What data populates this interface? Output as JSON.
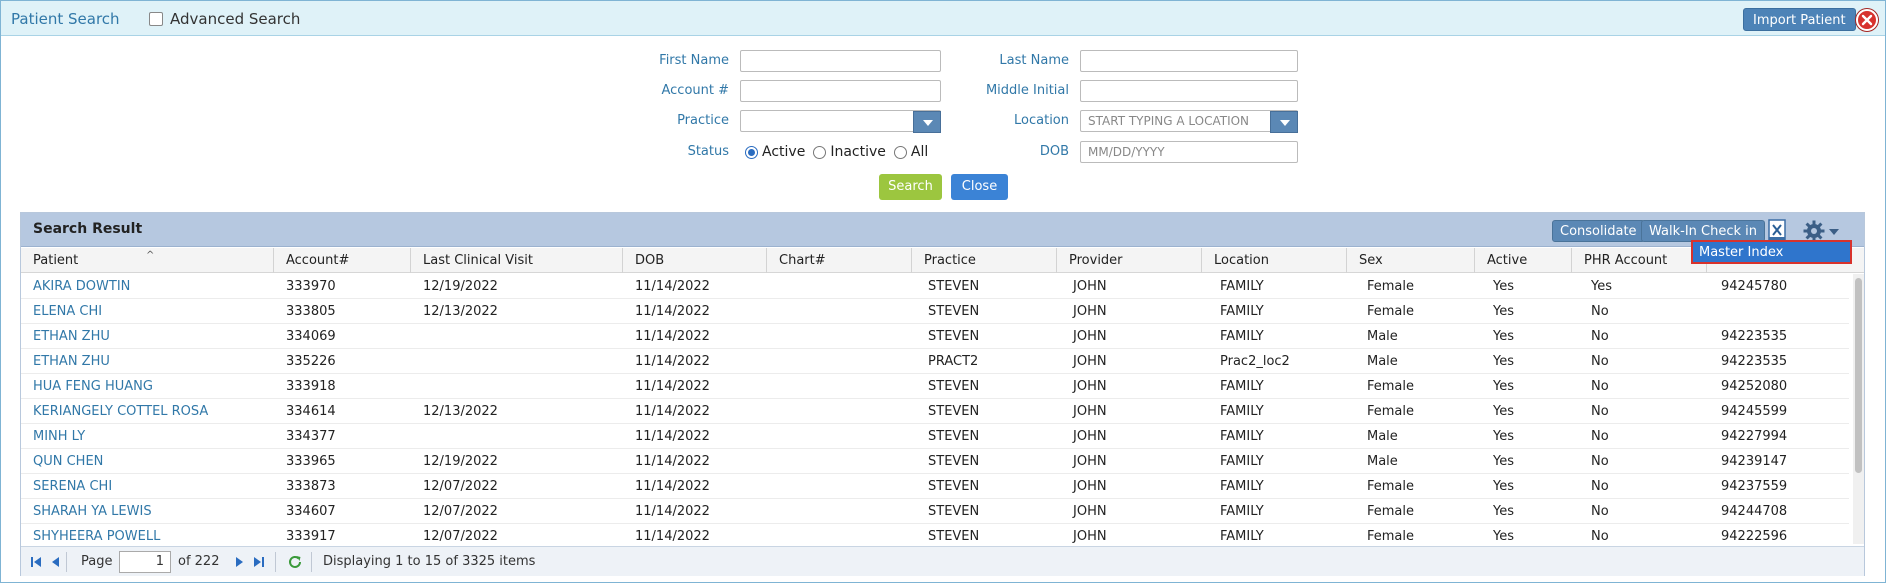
{
  "header": {
    "title": "Patient Search",
    "advanced_search_label": "Advanced Search",
    "import_button": "Import Patient",
    "close_icon": "close-icon"
  },
  "form": {
    "first_name_label": "First Name",
    "last_name_label": "Last Name",
    "account_label": "Account #",
    "middle_initial_label": "Middle Initial",
    "practice_label": "Practice",
    "location_label": "Location",
    "location_placeholder": "START TYPING A LOCATION",
    "status_label": "Status",
    "status_options": [
      "Active",
      "Inactive",
      "All"
    ],
    "status_selected": "Active",
    "dob_label": "DOB",
    "dob_placeholder": "MM/DD/YYYY",
    "search_button": "Search",
    "close_button": "Close"
  },
  "results": {
    "title": "Search Result",
    "consolidate_button": "Consolidate",
    "walkin_button": "Walk-In Check in",
    "export_icon": "excel-icon",
    "settings_icon": "gear-icon",
    "menu_item": "Master Index",
    "columns": [
      "Patient",
      "Account#",
      "Last Clinical Visit",
      "DOB",
      "Chart#",
      "Practice",
      "Provider",
      "Location",
      "Sex",
      "Active",
      "PHR Account",
      ""
    ],
    "rows": [
      [
        "AKIRA DOWTIN",
        "333970",
        "12/19/2022",
        "11/14/2022",
        "",
        "STEVEN",
        "JOHN",
        "FAMILY",
        "Female",
        "Yes",
        "Yes",
        "94245780"
      ],
      [
        "ELENA CHI",
        "333805",
        "12/13/2022",
        "11/14/2022",
        "",
        "STEVEN",
        "JOHN",
        "FAMILY",
        "Female",
        "Yes",
        "No",
        ""
      ],
      [
        "ETHAN ZHU",
        "334069",
        "",
        "11/14/2022",
        "",
        "STEVEN",
        "JOHN",
        "FAMILY",
        "Male",
        "Yes",
        "No",
        "94223535"
      ],
      [
        "ETHAN ZHU",
        "335226",
        "",
        "11/14/2022",
        "",
        "PRACT2",
        "JOHN",
        "Prac2_loc2",
        "Male",
        "Yes",
        "No",
        "94223535"
      ],
      [
        "HUA FENG HUANG",
        "333918",
        "",
        "11/14/2022",
        "",
        "STEVEN",
        "JOHN",
        "FAMILY",
        "Female",
        "Yes",
        "No",
        "94252080"
      ],
      [
        "KERIANGELY COTTEL ROSA",
        "334614",
        "12/13/2022",
        "11/14/2022",
        "",
        "STEVEN",
        "JOHN",
        "FAMILY",
        "Female",
        "Yes",
        "No",
        "94245599"
      ],
      [
        "MINH LY",
        "334377",
        "",
        "11/14/2022",
        "",
        "STEVEN",
        "JOHN",
        "FAMILY",
        "Male",
        "Yes",
        "No",
        "94227994"
      ],
      [
        "QUN CHEN",
        "333965",
        "12/19/2022",
        "11/14/2022",
        "",
        "STEVEN",
        "JOHN",
        "FAMILY",
        "Male",
        "Yes",
        "No",
        "94239147"
      ],
      [
        "SERENA CHI",
        "333873",
        "12/07/2022",
        "11/14/2022",
        "",
        "STEVEN",
        "JOHN",
        "FAMILY",
        "Female",
        "Yes",
        "No",
        "94237559"
      ],
      [
        "SHARAH YA LEWIS",
        "334607",
        "12/07/2022",
        "11/14/2022",
        "",
        "STEVEN",
        "JOHN",
        "FAMILY",
        "Female",
        "Yes",
        "No",
        "94244708"
      ],
      [
        "SHYHEERA POWELL",
        "333917",
        "12/07/2022",
        "11/14/2022",
        "",
        "STEVEN",
        "JOHN",
        "FAMILY",
        "Female",
        "Yes",
        "No",
        "94222596"
      ]
    ]
  },
  "pager": {
    "page_label": "Page",
    "page_value": "1",
    "of_label": "of 222",
    "display_text": "Displaying 1 to 15 of 3325 items"
  }
}
